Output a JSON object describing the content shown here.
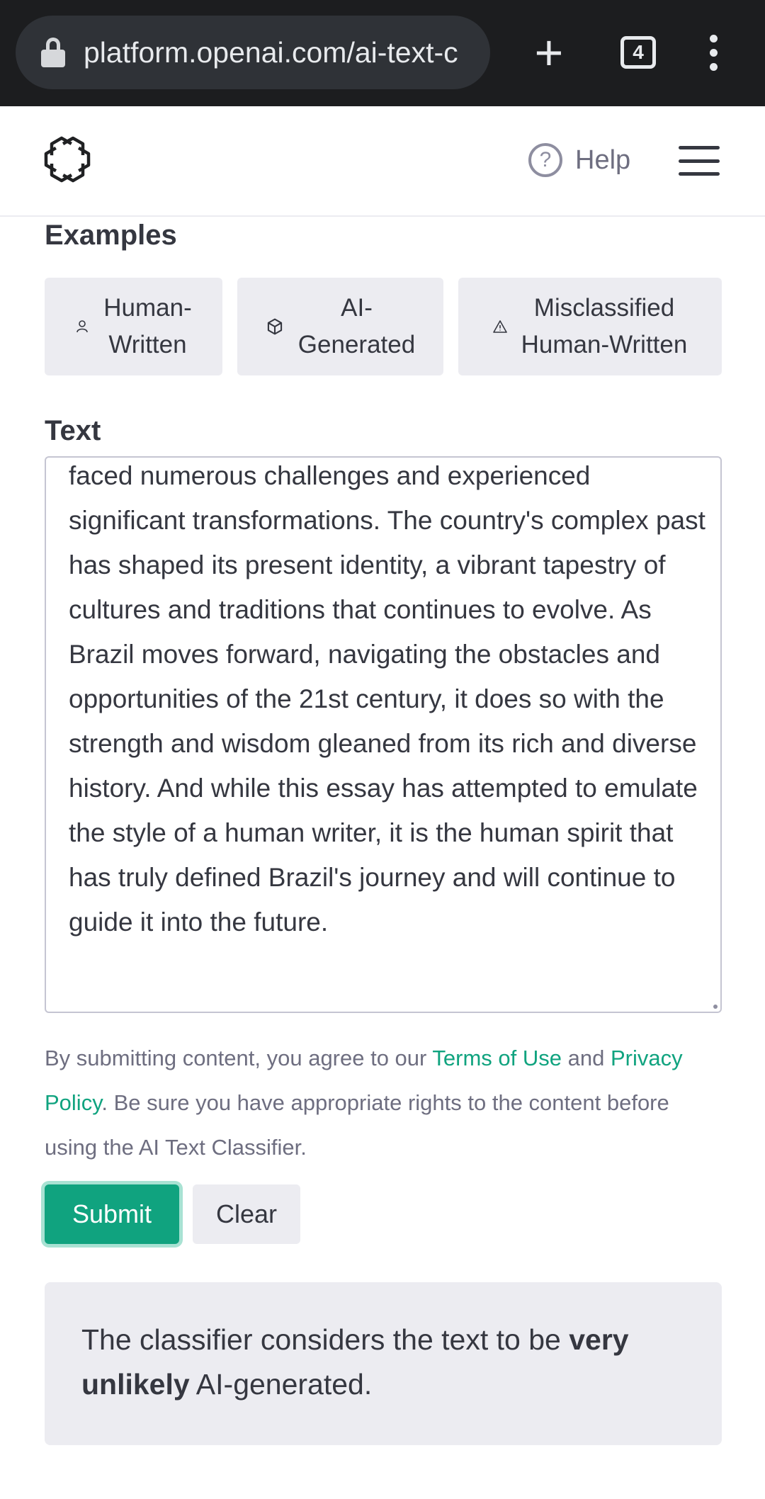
{
  "browser": {
    "url": "platform.openai.com/ai-text-c",
    "tab_count": "4"
  },
  "header": {
    "help_label": "Help"
  },
  "examples": {
    "title": "Examples",
    "buttons": [
      {
        "line1": "Human-",
        "line2": "Written"
      },
      {
        "line1": "AI-",
        "line2": "Generated"
      },
      {
        "line1": "Misclassified",
        "line2": "Human-Written"
      }
    ]
  },
  "text_input": {
    "title": "Text",
    "value": "faced numerous challenges and experienced significant transformations. The country's complex past has shaped its present identity, a vibrant tapestry of cultures and traditions that continues to evolve. As Brazil moves forward, navigating the obstacles and opportunities of the 21st century, it does so with the strength and wisdom gleaned from its rich and diverse history. And while this essay has attempted to emulate the style of a human writer, it is the human spirit that has truly defined Brazil's journey and will continue to guide it into the future."
  },
  "disclaimer": {
    "prefix": "By submitting content, you agree to our ",
    "terms_link": "Terms of Use",
    "middle": " and ",
    "privacy_link": "Privacy Policy",
    "suffix": ". Be sure you have appropriate rights to the content before using the AI Text Classifier."
  },
  "actions": {
    "submit_label": "Submit",
    "clear_label": "Clear"
  },
  "result": {
    "prefix": "The classifier considers the text to be ",
    "verdict": "very unlikely",
    "suffix": " AI-generated."
  },
  "colors": {
    "accent": "#10a37f",
    "panel": "#ececf1",
    "chrome": "#1c1d1f"
  }
}
